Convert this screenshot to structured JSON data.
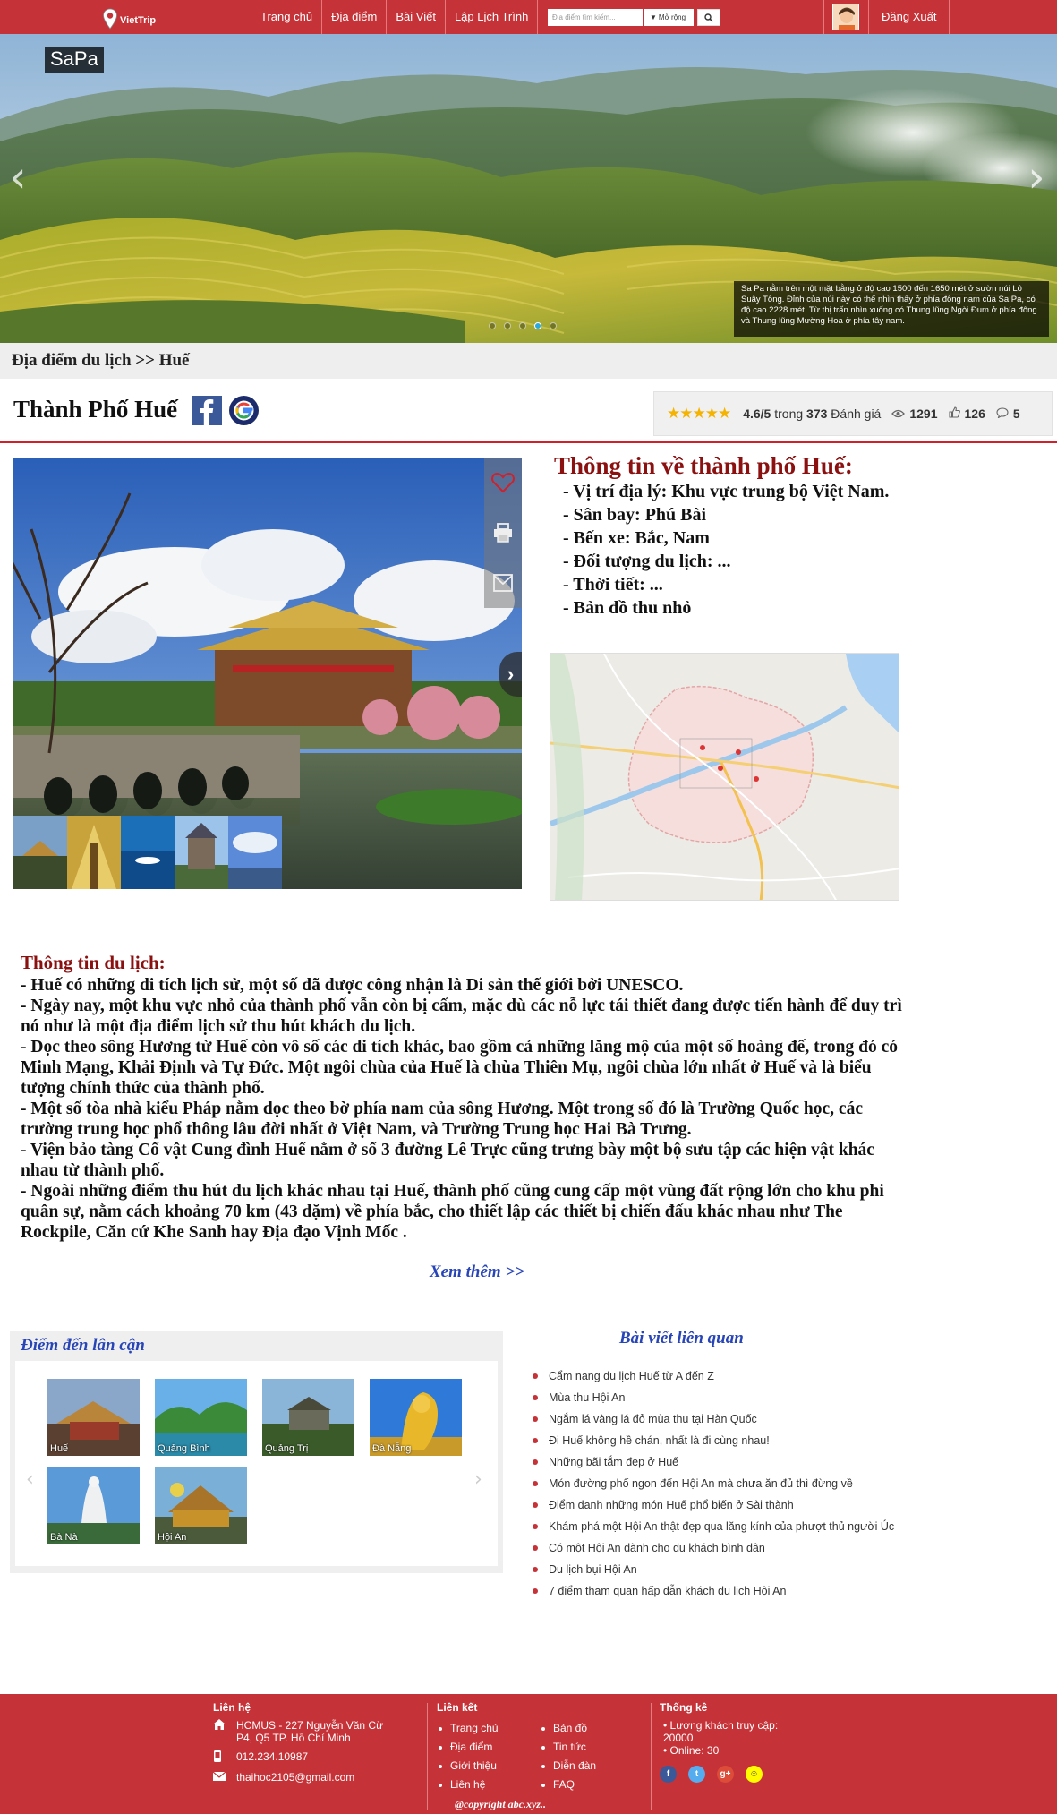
{
  "navbar": {
    "logo_text": "VietTrip",
    "menu": [
      "Trang chủ",
      "Địa điểm",
      "Bài Viết",
      "Lập Lịch Trình"
    ],
    "search_placeholder": "Địa điểm tìm kiếm...",
    "filter_label": "Mở rộng",
    "logout_label": "Đăng Xuất"
  },
  "hero": {
    "label": "SaPa",
    "caption": "Sa Pa nằm trên một mặt bằng ở độ cao 1500 đến 1650 mét ở sườn núi Lô Suây Tông. Đỉnh của núi này có thể nhìn thấy ở phía đông nam của Sa Pa, có độ cao 2228 mét. Từ thị trấn nhìn xuống có Thung lũng Ngòi Đum ở phía đông và Thung lũng Mường Hoa ở phía tây nam.",
    "prev_arrow": "‹",
    "next_arrow": "›",
    "slides": 5,
    "active_slide": 4
  },
  "breadcrumb": "Địa điểm du lịch >> Huế",
  "place": {
    "title": "Thành Phố Huế",
    "rating_stars": 4.6,
    "rating": "4.6/5",
    "rating_mid": "trong",
    "rating_count": "373",
    "rating_suffix": "Đánh giá",
    "views": "1291",
    "likes": "126",
    "comments": "5"
  },
  "gallery": {
    "next_arrow": "›",
    "icons": [
      "heart-icon",
      "print-icon",
      "mail-icon"
    ]
  },
  "city_info": {
    "title": "Thông tin về thành phố Huế:",
    "lines": [
      "- Vị trí địa lý: Khu vực trung bộ Việt Nam.",
      "- Sân bay: Phú Bài",
      "- Bến xe: Bắc, Nam",
      "- Đối tượng du lịch: ...",
      "- Thời tiết: ...",
      "- Bản đồ thu nhỏ"
    ]
  },
  "travel_info": {
    "title": "Thông tin du lịch:",
    "paragraphs": [
      "- Huế có những di tích lịch sử, một số đã được công nhận là Di sản thế giới bởi UNESCO.",
      "- Ngày nay, một khu vực nhỏ của thành phố vẫn còn bị cấm, mặc dù các nỗ lực tái thiết đang được tiến hành để duy trì nó như là một địa điểm lịch sử thu hút khách du lịch.",
      "- Dọc theo sông Hương từ Huế còn vô số các di tích khác, bao gồm cả những lăng mộ của một số hoàng đế, trong đó có Minh Mạng, Khải Định và Tự Đức. Một ngôi chùa của Huế là chùa Thiên Mụ, ngôi chùa lớn nhất ở Huế và là biểu tượng chính thức của thành phố.",
      "- Một số tòa nhà kiểu Pháp nằm dọc theo bờ phía nam của sông Hương. Một trong số đó là Trường Quốc học, các trường trung học phổ thông lâu đời nhất ở Việt Nam, và Trường Trung học Hai Bà Trưng.",
      "- Viện bảo tàng Cổ vật Cung đình Huế nằm ở số 3 đường Lê Trực cũng trưng bày một bộ sưu tập các hiện vật khác nhau từ thành phố.",
      "- Ngoài những điểm thu hút du lịch khác nhau tại Huế, thành phố cũng cung cấp một vùng đất rộng lớn cho khu phi quân sự, nằm cách khoảng 70 km (43 dặm) về phía bắc, cho thiết lập các thiết bị chiến đấu khác nhau như The Rockpile, Căn cứ Khe Sanh hay Địa đạo Vịnh Mốc ."
    ],
    "see_more": "Xem thêm >>"
  },
  "nearby": {
    "title": "Điểm đến lân cận",
    "places": [
      "Huế",
      "Quảng Bình",
      "Quảng Trị",
      "Đà Nẵng",
      "Bà Nà",
      "Hội An"
    ],
    "prev_arrow": "‹",
    "next_arrow": "›"
  },
  "related": {
    "title": "Bài viết liên quan",
    "items": [
      "Cẩm nang du lịch Huế từ A đến Z",
      "Mùa thu Hội An",
      "Ngắm lá vàng lá đỏ mùa thu tại Hàn Quốc",
      "Đi Huế không hề chán, nhất là đi cùng nhau!",
      "Những bãi tắm đẹp ở Huế",
      "Món đường phố ngon đến Hội An mà chưa ăn đủ thì đừng về",
      "Điểm danh những món Huế phổ biến ở Sài thành",
      "Khám phá một Hội An thật đẹp qua lăng kính của phượt thủ người Úc",
      "Có một Hội An dành cho du khách bình dân",
      "Du lịch bụi Hội An",
      "7 điểm tham quan hấp dẫn khách du lịch Hội An"
    ]
  },
  "footer": {
    "contact_title": "Liên hệ",
    "address": "HCMUS - 227 Nguyễn Văn Cừ P4, Q5 TP. Hồ Chí Minh",
    "phone": "012.234.10987",
    "email": "thaihoc2105@gmail.com",
    "links_title": "Liên kết",
    "links_col1": [
      "Trang chủ",
      "Địa điểm",
      "Giới thiệu",
      "Liên hệ"
    ],
    "links_col2": [
      "Bản đồ",
      "Tin tức",
      "Diễn đàn",
      "FAQ"
    ],
    "stats_title": "Thống kê",
    "visitors_label": "Lượng khách truy cập:",
    "visitors": "20000",
    "online": "Online: 30",
    "copyright": "@copyright abc.xyz..",
    "social": [
      {
        "name": "facebook-icon",
        "glyph": "f",
        "color": "#3b5998"
      },
      {
        "name": "twitter-icon",
        "glyph": "t",
        "color": "#55acee"
      },
      {
        "name": "google-plus-icon",
        "glyph": "g+",
        "color": "#dd4b39"
      },
      {
        "name": "snapchat-icon",
        "glyph": "☺",
        "color": "#fffc00"
      }
    ]
  },
  "colors": {
    "brand_red": "#c53237",
    "heading_dark_red": "#8b1111",
    "link_blue": "#2845b8",
    "star_gold": "#f5b301"
  }
}
